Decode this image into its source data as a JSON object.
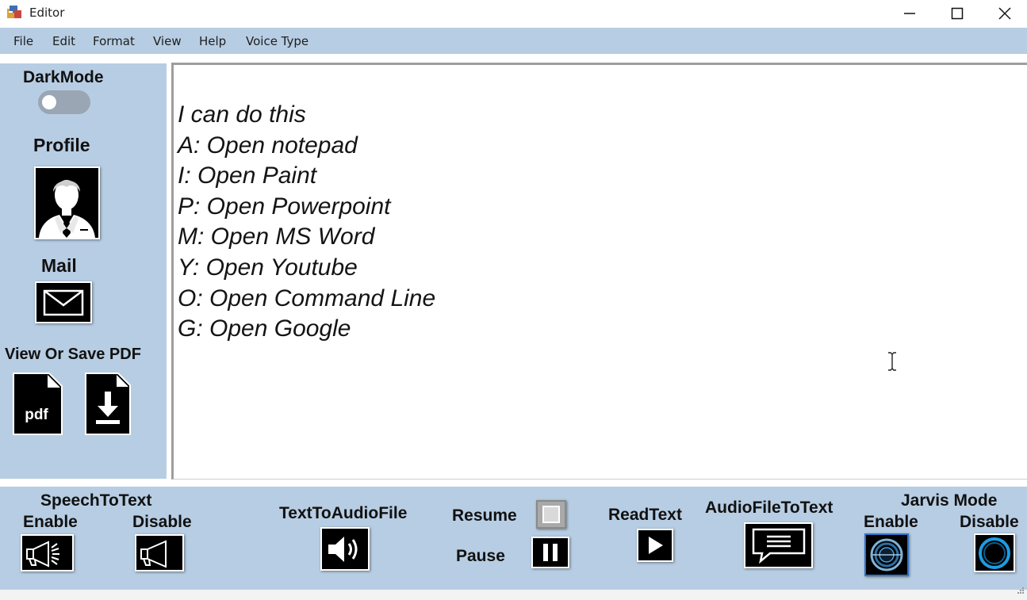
{
  "window": {
    "title": "Editor",
    "controls": [
      "minimize-icon",
      "maximize-icon",
      "close-icon"
    ]
  },
  "menu": {
    "items": [
      "File",
      "Edit",
      "Format",
      "View",
      "Help",
      "Voice Type"
    ]
  },
  "sidebar": {
    "darkmode_label": "DarkMode",
    "darkmode_on": false,
    "profile_label": "Profile",
    "mail_label": "Mail",
    "pdf_label": "View Or Save PDF",
    "pdf_icon_text": "pdf"
  },
  "editor": {
    "lines": [
      "I can do this",
      "A: Open notepad",
      "I: Open Paint",
      "P: Open Powerpoint",
      "M: Open MS Word",
      "Y: Open Youtube",
      "O: Open Command Line",
      "G: Open Google"
    ]
  },
  "toolbar": {
    "speech_to_text_label": "SpeechToText",
    "stt_enable_label": "Enable",
    "stt_disable_label": "Disable",
    "text_to_audio_label": "TextToAudioFile",
    "resume_label": "Resume",
    "pause_label": "Pause",
    "read_text_label": "ReadText",
    "audio_to_text_label": "AudioFileToText",
    "jarvis_label": "Jarvis Mode",
    "jarvis_enable_label": "Enable",
    "jarvis_disable_label": "Disable"
  },
  "colors": {
    "panel": "#b7cde3",
    "tile": "#000000",
    "jarvis_ring": "#1e9be0"
  }
}
